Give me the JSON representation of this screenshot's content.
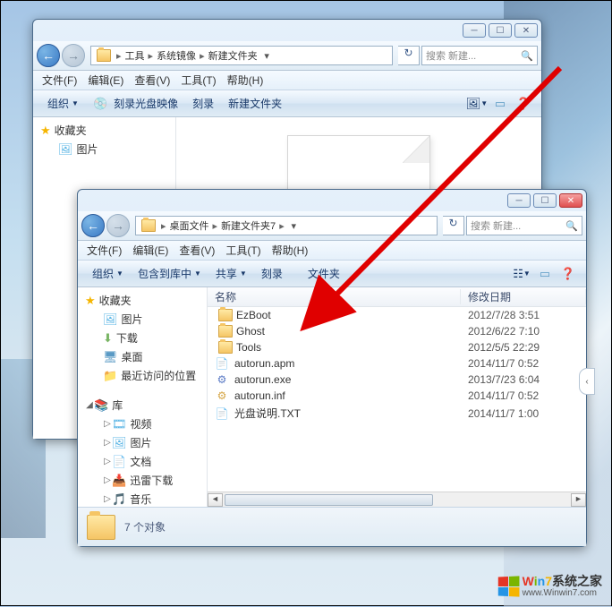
{
  "back": {
    "breadcrumb": [
      "工具",
      "系统镜像",
      "新建文件夹"
    ],
    "search_placeholder": "搜索 新建...",
    "menubar": [
      "文件(F)",
      "编辑(E)",
      "查看(V)",
      "工具(T)",
      "帮助(H)"
    ],
    "toolbar": {
      "organize": "组织",
      "burn_image": "刻录光盘映像",
      "burn": "刻录",
      "new_folder": "新建文件夹"
    },
    "sidebar": {
      "favorites": "收藏夹",
      "pictures": "图片"
    }
  },
  "front": {
    "breadcrumb": [
      "桌面文件",
      "新建文件夹7"
    ],
    "search_placeholder": "搜索 新建...",
    "menubar": [
      "文件(F)",
      "编辑(E)",
      "查看(V)",
      "工具(T)",
      "帮助(H)"
    ],
    "toolbar": {
      "organize": "组织",
      "include": "包含到库中",
      "share": "共享",
      "burn": "刻录",
      "new_folder_partial": "文件夹"
    },
    "sidebar": {
      "favorites": "收藏夹",
      "pictures": "图片",
      "downloads": "下载",
      "desktop": "桌面",
      "recent": "最近访问的位置",
      "libraries": "库",
      "videos": "视频",
      "pictures2": "图片",
      "documents": "文档",
      "thunder": "迅雷下载",
      "music": "音乐"
    },
    "columns": {
      "name": "名称",
      "date": "修改日期"
    },
    "files": [
      {
        "name": "EzBoot",
        "date": "2012/7/28 3:51",
        "type": "folder"
      },
      {
        "name": "Ghost",
        "date": "2012/6/22 7:10",
        "type": "folder"
      },
      {
        "name": "Tools",
        "date": "2012/5/5 22:29",
        "type": "folder"
      },
      {
        "name": "autorun.apm",
        "date": "2014/11/7 0:52",
        "type": "txt"
      },
      {
        "name": "autorun.exe",
        "date": "2013/7/23 6:04",
        "type": "exe"
      },
      {
        "name": "autorun.inf",
        "date": "2014/11/7 0:52",
        "type": "inf"
      },
      {
        "name": "光盘说明.TXT",
        "date": "2014/11/7 1:00",
        "type": "txt"
      }
    ],
    "status": "7 个对象"
  },
  "watermark": {
    "brand": "Win7系统之家",
    "url": "www.Winwin7.com"
  }
}
